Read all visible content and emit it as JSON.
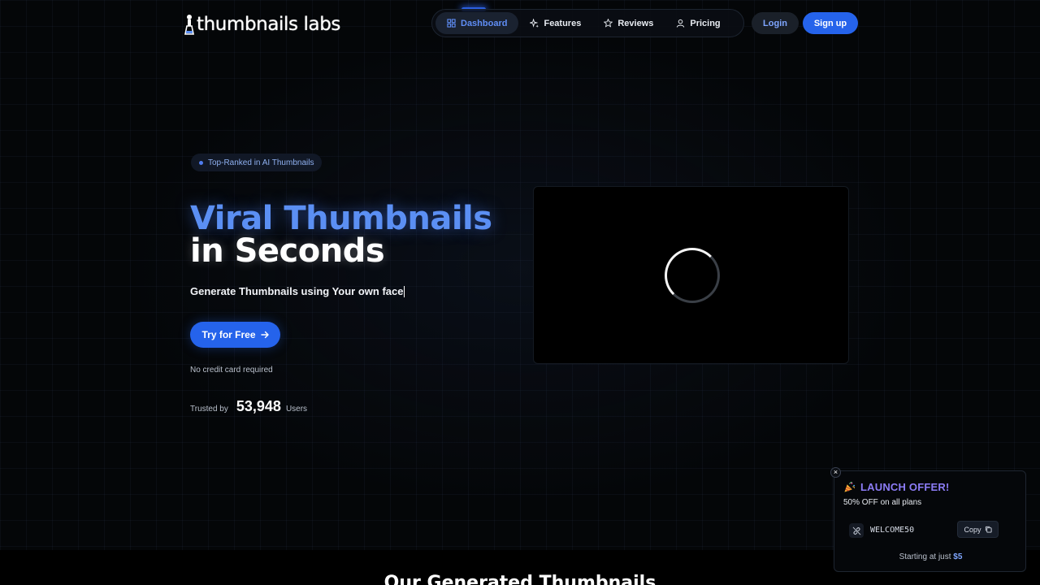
{
  "header": {
    "logo_text": "thumbnails labs",
    "nav": [
      {
        "label": "Dashboard",
        "icon": "dashboard-icon",
        "active": true
      },
      {
        "label": "Features",
        "icon": "sparkles-icon",
        "active": false
      },
      {
        "label": "Reviews",
        "icon": "star-icon",
        "active": false
      },
      {
        "label": "Pricing",
        "icon": "user-icon",
        "active": false
      }
    ],
    "login_label": "Login",
    "signup_label": "Sign up"
  },
  "hero": {
    "badge": "Top-Ranked in AI Thumbnails",
    "title_line1": "Viral Thumbnails",
    "title_line2": "in Seconds",
    "subtitle": "Generate Thumbnails using Your own face",
    "cta_label": "Try for Free",
    "note": "No credit card required",
    "trusted_label": "Trusted by",
    "trusted_count": "53,948",
    "trusted_unit": "Users"
  },
  "section": {
    "title": "Our Generated Thumbnails"
  },
  "offer": {
    "close": "×",
    "title": "LAUNCH OFFER!",
    "subtitle": "50% OFF on all plans",
    "code": "WELCOME50",
    "copy_label": "Copy",
    "price_prefix": "Starting at just",
    "price": "$5"
  },
  "colors": {
    "accent": "#2563eb",
    "accent_light": "#5b8ff3",
    "offer_title": "#8c7cf6",
    "background": "#040608"
  }
}
